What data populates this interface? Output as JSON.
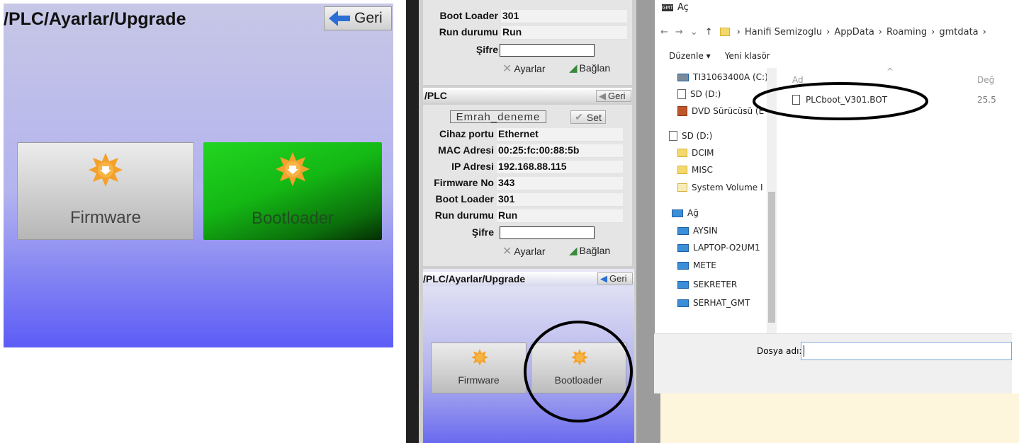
{
  "zoom_panel": {
    "title": "/PLC/Ayarlar/Upgrade",
    "back_label": "Geri",
    "buttons": [
      "Firmware",
      "Bootloader"
    ]
  },
  "device_panel": {
    "top_rows": [
      {
        "key": "Boot Loader",
        "value": "301"
      },
      {
        "key": "Run durumu",
        "value": "Run"
      }
    ],
    "password_label": "Şifre",
    "settings_label": "Ayarlar",
    "connect_label": "Bağlan",
    "plc_header": "/PLC",
    "back_label": "Geri",
    "name_field": "Emrah_deneme",
    "set_label": "Set",
    "rows": [
      {
        "key": "Cihaz portu",
        "value": "Ethernet"
      },
      {
        "key": "MAC Adresi",
        "value": "00:25:fc:00:88:5b"
      },
      {
        "key": "IP Adresi",
        "value": "192.168.88.115"
      },
      {
        "key": "Firmware No",
        "value": "343"
      },
      {
        "key": "Boot Loader",
        "value": "301"
      },
      {
        "key": "Run durumu",
        "value": "Run"
      }
    ],
    "upgrade_title": "/PLC/Ayarlar/Upgrade",
    "upgrade_buttons": [
      "Firmware",
      "Bootloader"
    ]
  },
  "dialog": {
    "title": "Aç",
    "breadcrumbs": [
      "Hanifi Semizoglu",
      "AppData",
      "Roaming",
      "gmtdata"
    ],
    "toolbar": [
      "Düzenle ▾",
      "Yeni klasör"
    ],
    "nav_items": [
      {
        "label": "TI31063400A (C:)",
        "icon": "drive-icon"
      },
      {
        "label": "SD (D:)",
        "icon": "drive-icon"
      },
      {
        "label": "DVD Sürücüsü (E",
        "icon": "dvd-icon"
      },
      {
        "label": "SD (D:)",
        "icon": "drive-icon"
      },
      {
        "label": "DCIM",
        "icon": "folder-icon"
      },
      {
        "label": "MISC",
        "icon": "folder-icon"
      },
      {
        "label": "System Volume I",
        "icon": "folder-icon"
      },
      {
        "label": "Ağ",
        "icon": "network-icon"
      },
      {
        "label": "AYSIN",
        "icon": "computer-icon"
      },
      {
        "label": "LAPTOP-O2UM1",
        "icon": "computer-icon"
      },
      {
        "label": "METE",
        "icon": "computer-icon"
      },
      {
        "label": "SEKRETER",
        "icon": "computer-icon"
      },
      {
        "label": "SERHAT_GMT",
        "icon": "computer-icon"
      }
    ],
    "column_name": "Ad",
    "column_date": "Değ",
    "file_name": "PLCboot_V301.BOT",
    "file_date": "25.5",
    "filename_label": "Dosya adı:"
  },
  "colors": {
    "accent_green": "#14b814",
    "panel_blue": "#5c5cf7",
    "icon_orange": "#f28c1e"
  }
}
